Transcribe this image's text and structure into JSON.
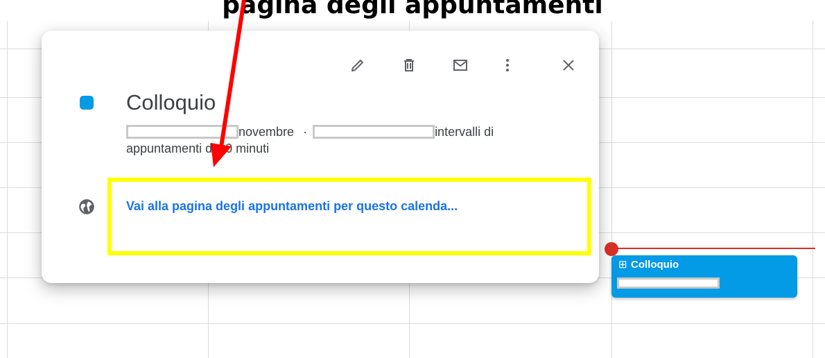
{
  "caption": "pagina degli appuntamenti",
  "popup": {
    "toolbar": {
      "edit_icon": "pencil-icon",
      "delete_icon": "trash-icon",
      "email_icon": "envelope-icon",
      "more_icon": "vertical-dots-icon",
      "close_icon": "close-icon"
    },
    "event_color": "#039be5",
    "title": "Colloquio",
    "detail_month": "novembre",
    "detail_separator": "·",
    "detail_tail": "intervalli di",
    "detail_line2": "appuntamenti di 10 minuti",
    "link_text": "Vai alla pagina degli appuntamenti per questo calenda...",
    "link_icon": "globe-icon"
  },
  "event_chip": {
    "icon": "⊞",
    "title": "Colloquio",
    "color": "#039be5"
  },
  "annotation": {
    "highlight_color": "#ffff00",
    "arrow_color": "#ff0000"
  }
}
